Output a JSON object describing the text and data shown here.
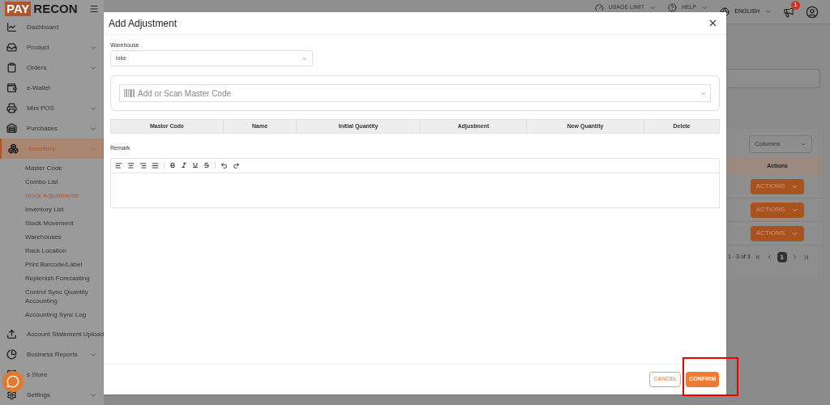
{
  "logo": {
    "part_1": "PAY",
    "part_2": "RECON"
  },
  "sidebar": {
    "items": [
      {
        "label": "Dashboard",
        "kind": "dashboard",
        "selected": false
      },
      {
        "label": "Product",
        "kind": "product",
        "expanded": false,
        "selected": false
      },
      {
        "label": "Orders",
        "kind": "orders",
        "expanded": false,
        "selected": false
      },
      {
        "label": "e-Wallet",
        "kind": "wallet",
        "selected": false
      },
      {
        "label": "Mini POS",
        "kind": "pos",
        "expanded": false,
        "selected": false
      },
      {
        "label": "Purchases",
        "kind": "purchases",
        "expanded": false,
        "selected": false
      },
      {
        "label": "Inventory",
        "kind": "inventory",
        "expanded": true,
        "selected": true,
        "children": [
          {
            "label": "Master Code",
            "selected": false
          },
          {
            "label": "Combo List",
            "selected": false
          },
          {
            "label": "Stock Adjustments",
            "selected": true
          },
          {
            "label": "Inventory List",
            "selected": false
          },
          {
            "label": "Stock Movement",
            "selected": false
          },
          {
            "label": "Warehouses",
            "selected": false
          },
          {
            "label": "Rack Location",
            "selected": false
          },
          {
            "label": "Print Barcode/Label",
            "selected": false
          },
          {
            "label": "Replenish Forecasting",
            "selected": false
          },
          {
            "label": "Control Sync Quantity Accounting",
            "selected": false
          },
          {
            "label": "Accounting Sync Log",
            "selected": false
          }
        ]
      },
      {
        "label": "Account Statement Upload",
        "kind": "upload",
        "selected": false
      },
      {
        "label": "Business Reports",
        "kind": "reports",
        "expanded": false,
        "selected": false
      },
      {
        "label": "s Store",
        "kind": "store",
        "selected": false
      },
      {
        "label": "Settings",
        "kind": "settings",
        "expanded": false,
        "selected": false
      }
    ]
  },
  "top_bar": {
    "usage": "USAGE LIMIT",
    "help": "HELP",
    "language": "ENGLISH",
    "notification_count": "1"
  },
  "background_table": {
    "columns_button": "Columns",
    "actions_header": "Actions",
    "rows": [
      {
        "action": "ACTIONS"
      },
      {
        "action": "ACTIONS"
      },
      {
        "action": "ACTIONS"
      }
    ],
    "pagination": {
      "range": "1 - 3 of 3",
      "page": "1"
    }
  },
  "dialog": {
    "title": "Add Adjustment",
    "warehouse": {
      "label": "Warehouse",
      "value": "loke"
    },
    "scan": {
      "placeholder": "Add or Scan Master Code"
    },
    "table": {
      "columns": [
        "Master Code",
        "Name",
        "Initial Quantity",
        "Adjustment",
        "New Quantity",
        "Delete"
      ]
    },
    "remark": {
      "label": "Remark"
    },
    "buttons": [
      {
        "label": "CANCEL",
        "kind": "outline"
      },
      {
        "label": "CONFIRM",
        "kind": "primary"
      }
    ]
  }
}
